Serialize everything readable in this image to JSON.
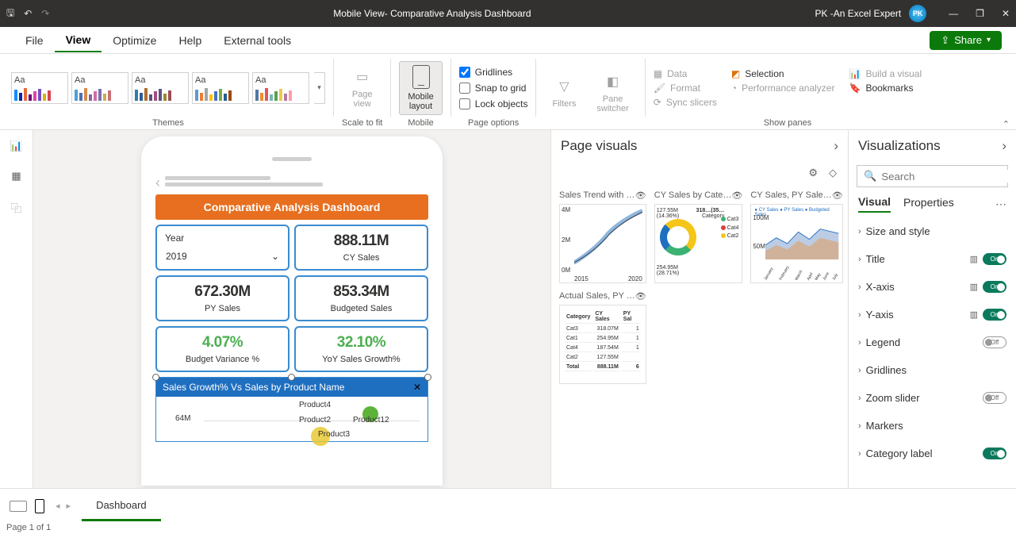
{
  "titlebar": {
    "title": "Mobile View- Comparative Analysis Dashboard",
    "user": "PK -An Excel Expert"
  },
  "menu": {
    "file": "File",
    "view": "View",
    "optimize": "Optimize",
    "help": "Help",
    "external": "External tools",
    "share": "Share"
  },
  "ribbon": {
    "themes_label": "Themes",
    "scale_label": "Scale to fit",
    "mobile_label": "Mobile",
    "pageopt_label": "Page options",
    "panes_label": "Show panes",
    "page_view": "Page\nview",
    "mobile_layout": "Mobile\nlayout",
    "gridlines": "Gridlines",
    "snap": "Snap to grid",
    "lock": "Lock objects",
    "filters": "Filters",
    "pane_switcher": "Pane\nswitcher",
    "data": "Data",
    "format": "Format",
    "bookmarks": "Bookmarks",
    "selection": "Selection",
    "perf": "Performance analyzer",
    "sync": "Sync slicers",
    "build": "Build a visual",
    "theme_aa": "Aa"
  },
  "dashboard": {
    "title": "Comparative Analysis Dashboard",
    "year_label": "Year",
    "year_value": "2019",
    "cards": [
      {
        "val": "888.11M",
        "lbl": "CY Sales",
        "green": false
      },
      {
        "val": "672.30M",
        "lbl": "PY Sales",
        "green": false
      },
      {
        "val": "853.34M",
        "lbl": "Budgeted Sales",
        "green": false
      },
      {
        "val": "4.07%",
        "lbl": "Budget Variance %",
        "green": true
      },
      {
        "val": "32.10%",
        "lbl": "YoY Sales Growth%",
        "green": true
      }
    ],
    "chart_title": "Sales Growth% Vs Sales by Product Name",
    "chart_yval": "64M",
    "chart_prods": {
      "p2": "Product2",
      "p3": "Product3",
      "p4": "Product4",
      "p12": "Product12"
    }
  },
  "page_visuals": {
    "title": "Page visuals",
    "items": [
      {
        "name": "Sales Trend with …"
      },
      {
        "name": "CY Sales by Cate…"
      },
      {
        "name": "CY Sales, PY Sale…"
      },
      {
        "name": "Actual Sales, PY …"
      }
    ],
    "trend": {
      "y1": "4M",
      "y2": "2M",
      "y3": "0M",
      "x1": "2015",
      "x2": "2020"
    },
    "donut": {
      "top": "127.55M\n(14.36%)",
      "bot": "254.95M\n(28.71%)",
      "side_label": "Category",
      "side_val": "318…(35…",
      "legend": [
        "Cat3",
        "Cat4",
        "Cat2"
      ]
    },
    "area": {
      "legend": "● CY Sales ● PY Sales ● Budgeted Sales",
      "y1": "100M",
      "y2": "50M",
      "months": [
        "January",
        "February",
        "March",
        "April",
        "May",
        "June",
        "July"
      ]
    },
    "table": {
      "headers": [
        "Category",
        "CY Sales",
        "PY Sal"
      ],
      "rows": [
        [
          "Cat3",
          "318.07M",
          "1"
        ],
        [
          "Cat1",
          "254.95M",
          "1"
        ],
        [
          "Cat4",
          "187.54M",
          "1"
        ],
        [
          "Cat2",
          "127.55M",
          ""
        ],
        [
          "Total",
          "888.11M",
          "6"
        ]
      ]
    }
  },
  "visualizations": {
    "title": "Visualizations",
    "search_placeholder": "Search",
    "tab_visual": "Visual",
    "tab_props": "Properties",
    "rows": [
      {
        "name": "Size and style",
        "fx": false,
        "toggle": null
      },
      {
        "name": "Title",
        "fx": true,
        "toggle": "on"
      },
      {
        "name": "X-axis",
        "fx": true,
        "toggle": "on"
      },
      {
        "name": "Y-axis",
        "fx": true,
        "toggle": "on"
      },
      {
        "name": "Legend",
        "fx": false,
        "toggle": "off"
      },
      {
        "name": "Gridlines",
        "fx": false,
        "toggle": null
      },
      {
        "name": "Zoom slider",
        "fx": false,
        "toggle": "off"
      },
      {
        "name": "Markers",
        "fx": false,
        "toggle": null
      },
      {
        "name": "Category label",
        "fx": false,
        "toggle": "on"
      }
    ]
  },
  "pagetabs": {
    "tab": "Dashboard"
  },
  "statusbar": {
    "text": "Page 1 of 1"
  },
  "colors": {
    "theme_palettes": [
      [
        "#118DFF",
        "#12239E",
        "#E66C37",
        "#6B007B",
        "#E044A7",
        "#744EC2",
        "#D9B300",
        "#D64550"
      ],
      [
        "#4C9FD8",
        "#4C72B0",
        "#D88C4C",
        "#8065A3",
        "#CF6CA6",
        "#7B6FAD",
        "#C9AE4C",
        "#C96F76"
      ],
      [
        "#2F7BB0",
        "#2F5E8F",
        "#B06F2F",
        "#5F4E7B",
        "#A34E7E",
        "#5E527E",
        "#9B8A2F",
        "#9B4E55"
      ],
      [
        "#5B9BD5",
        "#ED7D31",
        "#A5A5A5",
        "#FFC000",
        "#4472C4",
        "#70AD47",
        "#255E91",
        "#9E480E"
      ],
      [
        "#4E79A7",
        "#F28E2B",
        "#E15759",
        "#76B7B2",
        "#59A14F",
        "#EDC948",
        "#B07AA1",
        "#FF9DA7"
      ]
    ]
  }
}
